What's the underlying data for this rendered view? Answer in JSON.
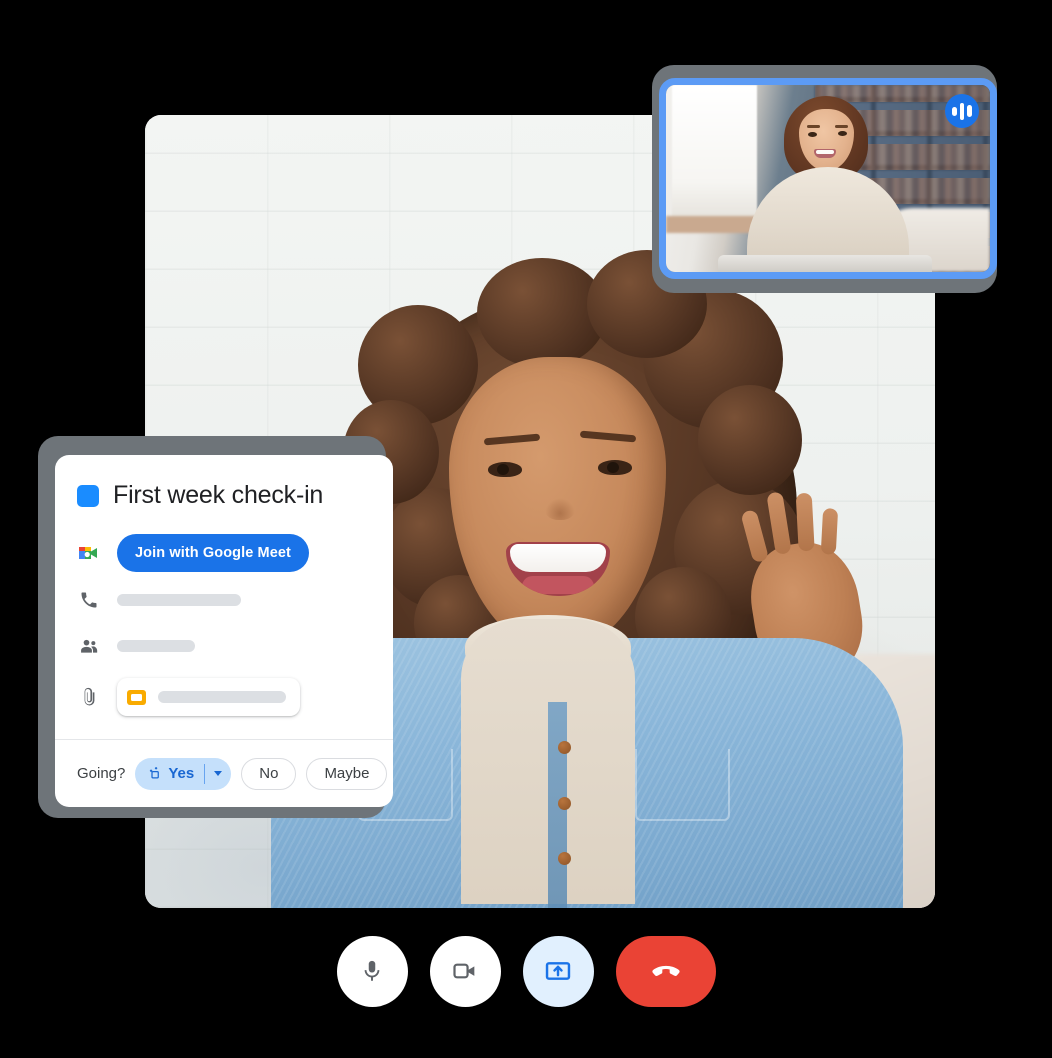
{
  "app": {
    "name": "Google Meet video call",
    "background_color": "#000000"
  },
  "main_video": {
    "label": "main-participant-video",
    "participant_description": "Smiling person with curly hair in denim jacket waving"
  },
  "pip_video": {
    "label": "self-view-video",
    "participant_description": "Person seated in front of bookshelf",
    "border_color": "#5c9bf5",
    "speaking_badge": {
      "name": "speaking-indicator",
      "color": "#1a73e8"
    }
  },
  "event_card": {
    "color_chip": "#1a8cff",
    "title": "First week check-in",
    "meet_icon_name": "google-meet-icon",
    "join_button_label": "Join with Google Meet",
    "join_button_color": "#1a73e8",
    "rows": [
      {
        "icon": "phone-icon",
        "value": ""
      },
      {
        "icon": "people-icon",
        "value": ""
      },
      {
        "icon": "attachment-icon",
        "value": ""
      }
    ],
    "attachment": {
      "file_icon_name": "slides-file-icon",
      "file_icon_color": "#f9ab00",
      "name": ""
    },
    "footer": {
      "going_label": "Going?",
      "rsvp_options": [
        {
          "label": "Yes",
          "selected": true,
          "icon": "rsvp-location-icon",
          "caret": "chevron-down-icon"
        },
        {
          "label": "No",
          "selected": false
        },
        {
          "label": "Maybe",
          "selected": false
        }
      ]
    }
  },
  "controls": [
    {
      "name": "microphone-button",
      "icon": "microphone-icon",
      "style": "white",
      "state": "on"
    },
    {
      "name": "camera-button",
      "icon": "video-camera-icon",
      "style": "white",
      "state": "on"
    },
    {
      "name": "present-screen-button",
      "icon": "present-screen-icon",
      "style": "blue",
      "state": "active"
    },
    {
      "name": "end-call-button",
      "icon": "phone-hangup-icon",
      "style": "red",
      "state": "idle"
    }
  ],
  "colors": {
    "accent_blue": "#1a73e8",
    "light_blue": "#e1f0fe",
    "end_call_red": "#ea4335",
    "placeholder_gray": "#dcdfe3",
    "shadow_gray": "#6e7479"
  }
}
